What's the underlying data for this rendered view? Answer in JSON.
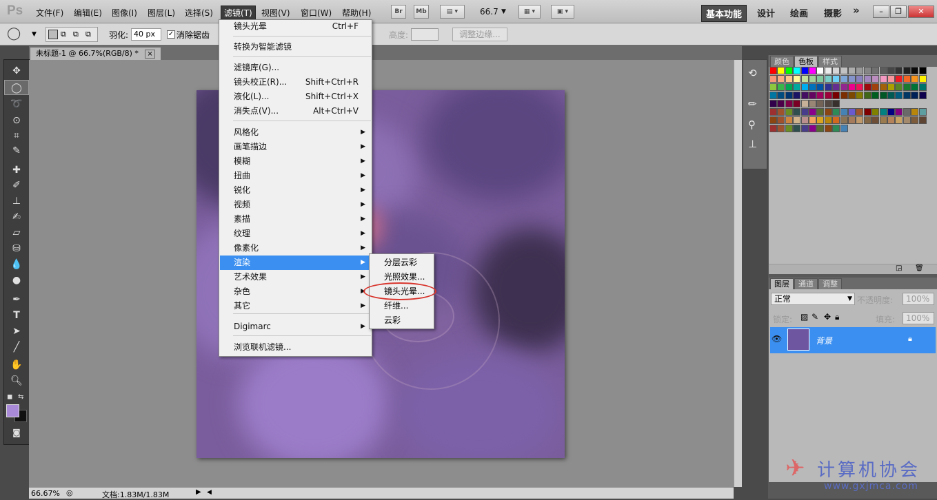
{
  "app": {
    "logo": "Ps"
  },
  "menubar": {
    "items": [
      "文件(F)",
      "编辑(E)",
      "图像(I)",
      "图层(L)",
      "选择(S)",
      "滤镜(T)",
      "视图(V)",
      "窗口(W)",
      "帮助(H)"
    ],
    "bridge_label": "Br",
    "minibridge_label": "Mb",
    "zoom_value": "66.7",
    "workspaces": [
      "基本功能",
      "设计",
      "绘画",
      "摄影"
    ],
    "more": "»"
  },
  "options": {
    "feather_label": "羽化:",
    "feather_value": "40 px",
    "antialias_label": "消除锯齿",
    "height_label": "高度:",
    "refine_edge": "调整边缘..."
  },
  "document": {
    "tab_title": "未标题-1 @ 66.7%(RGB/8) *",
    "close": "×"
  },
  "filter_menu": {
    "items": [
      {
        "label": "镜头光晕",
        "shortcut": "Ctrl+F"
      },
      {
        "label": "转换为智能滤镜"
      },
      {
        "label": "滤镜库(G)..."
      },
      {
        "label": "镜头校正(R)...",
        "shortcut": "Shift+Ctrl+R"
      },
      {
        "label": "液化(L)...",
        "shortcut": "Shift+Ctrl+X"
      },
      {
        "label": "消失点(V)...",
        "shortcut": "Alt+Ctrl+V"
      },
      {
        "label": "风格化",
        "arrow": "▶"
      },
      {
        "label": "画笔描边",
        "arrow": "▶"
      },
      {
        "label": "模糊",
        "arrow": "▶"
      },
      {
        "label": "扭曲",
        "arrow": "▶"
      },
      {
        "label": "锐化",
        "arrow": "▶"
      },
      {
        "label": "视频",
        "arrow": "▶"
      },
      {
        "label": "素描",
        "arrow": "▶"
      },
      {
        "label": "纹理",
        "arrow": "▶"
      },
      {
        "label": "像素化",
        "arrow": "▶"
      },
      {
        "label": "渲染",
        "arrow": "▶"
      },
      {
        "label": "艺术效果",
        "arrow": "▶"
      },
      {
        "label": "杂色",
        "arrow": "▶"
      },
      {
        "label": "其它",
        "arrow": "▶"
      },
      {
        "label": "Digimarc",
        "arrow": "▶"
      },
      {
        "label": "浏览联机滤镜..."
      }
    ],
    "highlighted": "渲染"
  },
  "render_submenu": {
    "items": [
      "分层云彩",
      "光照效果...",
      "镜头光晕...",
      "纤维...",
      "云彩"
    ],
    "circled": "镜头光晕..."
  },
  "status": {
    "zoom": "66.67%",
    "doc_info": "文档:1.83M/1.83M"
  },
  "swatches_panel": {
    "tabs": [
      "颜色",
      "色板",
      "样式"
    ],
    "active_tab": "色板"
  },
  "layers_panel": {
    "tabs": [
      "图层",
      "通道",
      "调整"
    ],
    "blend_mode": "正常",
    "opacity_label": "不透明度:",
    "opacity_value": "100%",
    "lock_label": "锁定:",
    "fill_label": "填充:",
    "fill_value": "100%",
    "layer_name": "背景"
  },
  "watermark": {
    "text": "计算机协会",
    "url": "www.gxjmca.com"
  },
  "colors": {
    "foreground": "#a98ad8",
    "background": "#111111",
    "highlight": "#3b8ff0",
    "annotation": "#d8362e"
  }
}
